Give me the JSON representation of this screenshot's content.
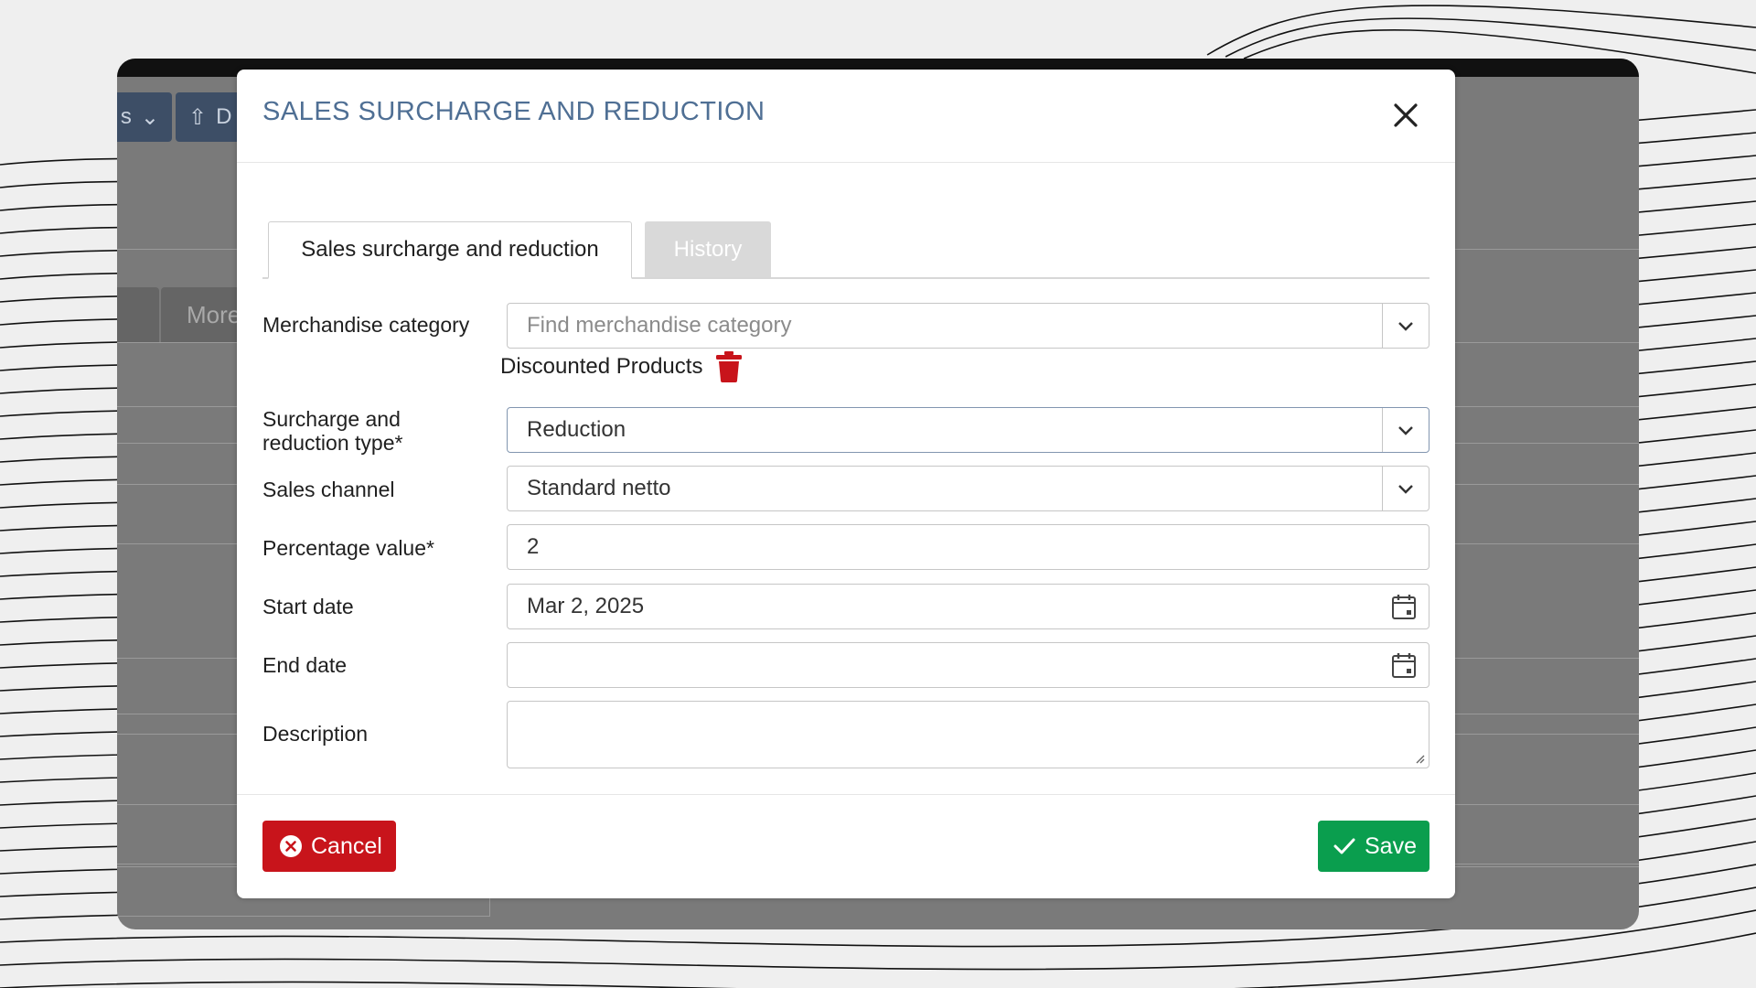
{
  "app_background": {
    "toolbar_button_1": "s",
    "toolbar_button_2": "D",
    "tab_more": "More"
  },
  "modal": {
    "title": "SALES SURCHARGE AND REDUCTION",
    "tabs": [
      {
        "label": "Sales surcharge and reduction",
        "active": true
      },
      {
        "label": "History",
        "active": false
      }
    ],
    "fields": {
      "merchandise_category": {
        "label": "Merchandise category",
        "placeholder": "Find merchandise category",
        "value": ""
      },
      "selected_category": {
        "label": "Discounted Products"
      },
      "type": {
        "label_line1": "Surcharge and",
        "label_line2": "reduction type*",
        "value": "Reduction"
      },
      "sales_channel": {
        "label": "Sales channel",
        "value": "Standard netto"
      },
      "percentage": {
        "label": "Percentage value*",
        "value": "2"
      },
      "start_date": {
        "label": "Start date",
        "value": "Mar 2, 2025"
      },
      "end_date": {
        "label": "End date",
        "value": ""
      },
      "description": {
        "label": "Description",
        "value": ""
      }
    },
    "buttons": {
      "cancel": "Cancel",
      "save": "Save"
    }
  },
  "colors": {
    "title": "#4f6f94",
    "cancel": "#c8141b",
    "save": "#0a9e4e",
    "trash": "#c8141b",
    "overlay": "#7a7a7a"
  },
  "icons": [
    "close-icon",
    "chevron-down-icon",
    "trash-icon",
    "calendar-icon",
    "times-circle-icon",
    "check-icon",
    "upload-icon"
  ]
}
